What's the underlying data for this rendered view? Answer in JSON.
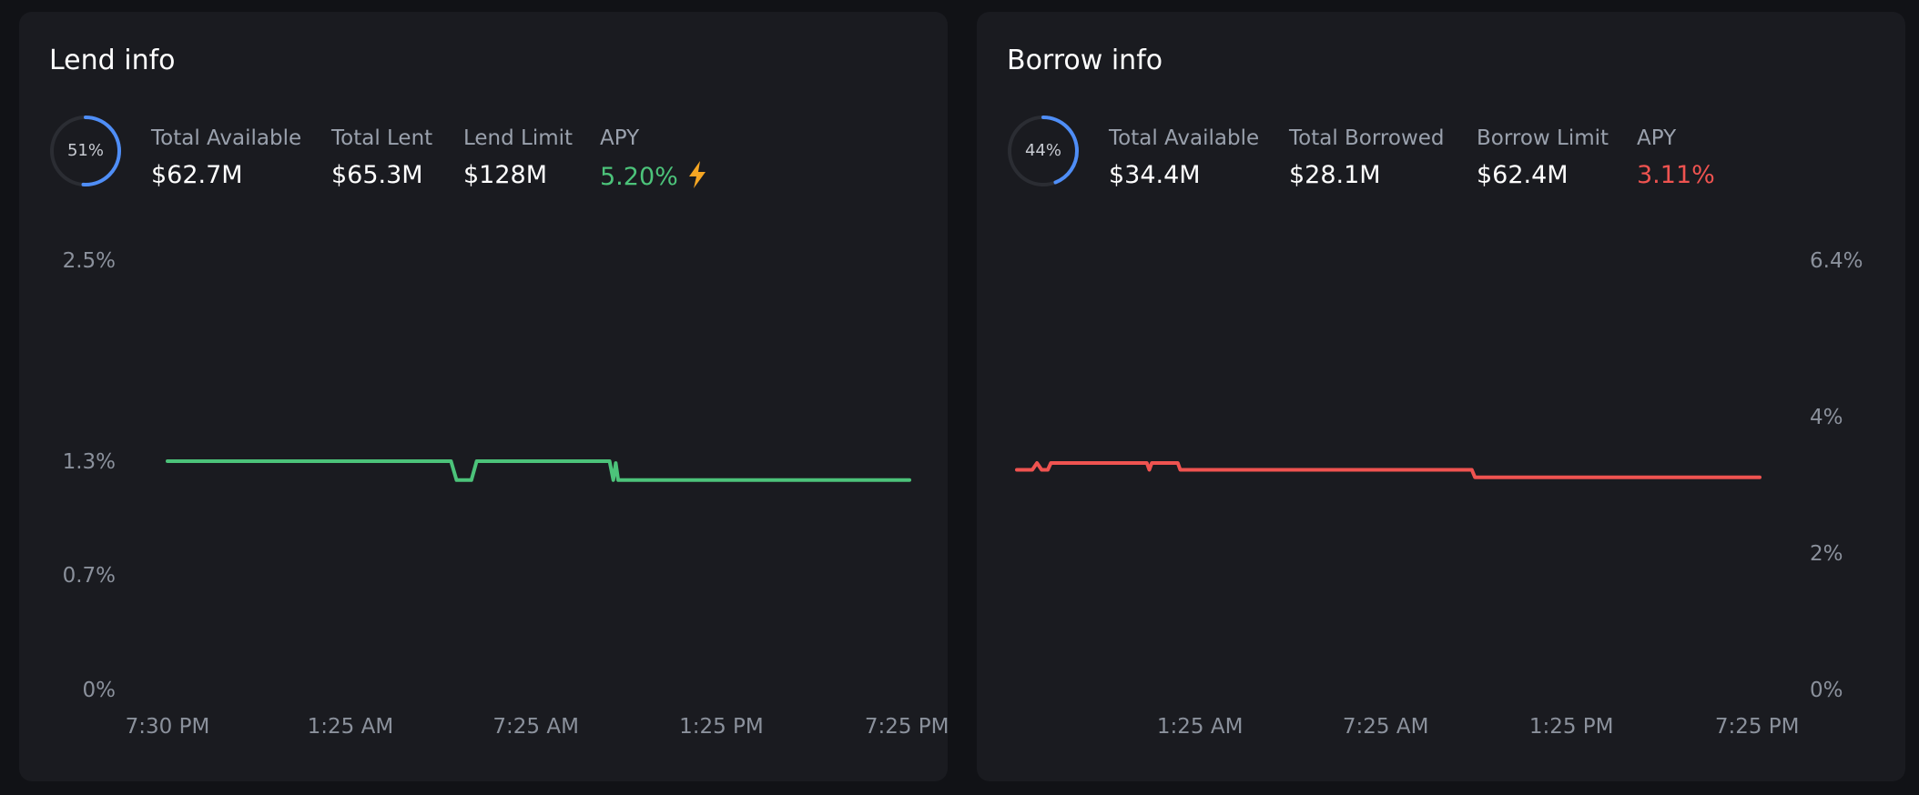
{
  "lend": {
    "title": "Lend info",
    "utilization": {
      "label": "51%",
      "value": 0.51
    },
    "stats": [
      {
        "label": "Total Available",
        "value": "$62.7M"
      },
      {
        "label": "Total Lent",
        "value": "$65.3M"
      },
      {
        "label": "Lend Limit",
        "value": "$128M"
      }
    ],
    "apy": {
      "label": "APY",
      "value": "5.20%",
      "color": "#4cc37a",
      "icon": "lightning-bolt-icon"
    }
  },
  "borrow": {
    "title": "Borrow info",
    "utilization": {
      "label": "44%",
      "value": 0.44
    },
    "stats": [
      {
        "label": "Total Available",
        "value": "$34.4M"
      },
      {
        "label": "Total Borrowed",
        "value": "$28.1M"
      },
      {
        "label": "Borrow Limit",
        "value": "$62.4M"
      }
    ],
    "apy": {
      "label": "APY",
      "value": "3.11%",
      "color": "#ef5350"
    }
  },
  "colors": {
    "accent_ring": "#4f8ef7",
    "ring_track": "#2b2d33",
    "lend_line": "#4cc37a",
    "borrow_line": "#ef5350",
    "bolt": "#f5a623"
  },
  "chart_data": [
    {
      "type": "line",
      "title": "",
      "xlabel": "",
      "ylabel": "",
      "y_axis_position": "left",
      "x_tick_labels": [
        "7:30 PM",
        "1:25 AM",
        "7:25 AM",
        "1:25 PM",
        "7:25 PM"
      ],
      "x_tick_hours": [
        0,
        5.917,
        11.917,
        17.917,
        23.917
      ],
      "y_ticks": [
        "2.5%",
        "1.3%",
        "0.7%",
        "0%"
      ],
      "y_tick_values": [
        2.5,
        1.3,
        0.7,
        0
      ],
      "grid": false,
      "series": [
        {
          "color": "#4cc37a",
          "points": [
            [
              0,
              1.3
            ],
            [
              9.17,
              1.3
            ],
            [
              9.35,
              1.2
            ],
            [
              9.83,
              1.2
            ],
            [
              10.0,
              1.3
            ],
            [
              14.3,
              1.3
            ],
            [
              14.42,
              1.2
            ],
            [
              14.5,
              1.29
            ],
            [
              14.58,
              1.2
            ],
            [
              24,
              1.2
            ]
          ]
        }
      ]
    },
    {
      "type": "line",
      "title": "",
      "xlabel": "",
      "ylabel": "",
      "y_axis_position": "right",
      "x_tick_labels": [
        "1:25 AM",
        "7:25 AM",
        "1:25 PM",
        "7:25 PM"
      ],
      "x_tick_hours": [
        5.917,
        11.917,
        17.917,
        23.917
      ],
      "y_ticks": [
        "6.4%",
        "4%",
        "2%",
        "0%"
      ],
      "y_tick_values": [
        6.4,
        4,
        2,
        0
      ],
      "grid": false,
      "series": [
        {
          "color": "#ef5350",
          "points": [
            [
              0,
              3.22
            ],
            [
              0.5,
              3.22
            ],
            [
              0.65,
              3.32
            ],
            [
              0.8,
              3.22
            ],
            [
              1.0,
              3.22
            ],
            [
              1.1,
              3.32
            ],
            [
              4.2,
              3.32
            ],
            [
              4.28,
              3.22
            ],
            [
              4.36,
              3.32
            ],
            [
              5.2,
              3.32
            ],
            [
              5.28,
              3.22
            ],
            [
              14.7,
              3.22
            ],
            [
              14.8,
              3.11
            ],
            [
              24,
              3.11
            ]
          ]
        }
      ]
    }
  ]
}
